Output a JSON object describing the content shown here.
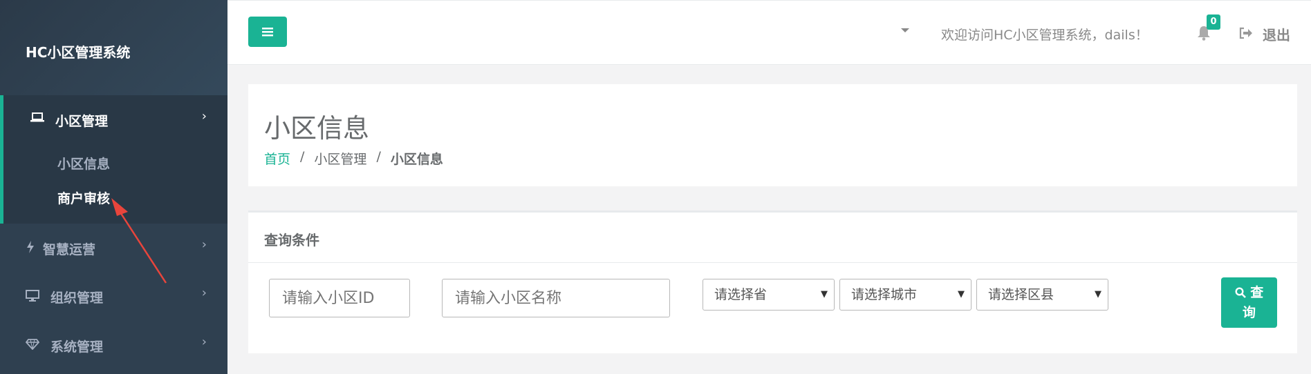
{
  "sidebar": {
    "brand": "HC小区管理系统",
    "items": [
      {
        "label": "小区管理",
        "icon": "laptop-icon",
        "expanded": true,
        "children": [
          {
            "label": "小区信息"
          },
          {
            "label": "商户审核"
          }
        ]
      },
      {
        "label": "智慧运营",
        "icon": "bolt-icon"
      },
      {
        "label": "组织管理",
        "icon": "desktop-icon"
      },
      {
        "label": "系统管理",
        "icon": "diamond-icon"
      }
    ]
  },
  "topbar": {
    "welcome": "欢迎访问HC小区管理系统，dails！",
    "notifications": "0",
    "logout": "退出"
  },
  "page": {
    "title": "小区信息",
    "breadcrumb": [
      "首页",
      "小区管理",
      "小区信息"
    ],
    "breadcrumb_sep": "/"
  },
  "query": {
    "title": "查询条件",
    "id_placeholder": "请输入小区ID",
    "name_placeholder": "请输入小区名称",
    "province": "请选择省",
    "city": "请选择城市",
    "district": "请选择区县",
    "search_label_1": "查",
    "search_label_2": "询"
  },
  "colors": {
    "accent": "#1ab394",
    "sidebar_bg": "#2f4050",
    "arrow": "#e8453c"
  }
}
